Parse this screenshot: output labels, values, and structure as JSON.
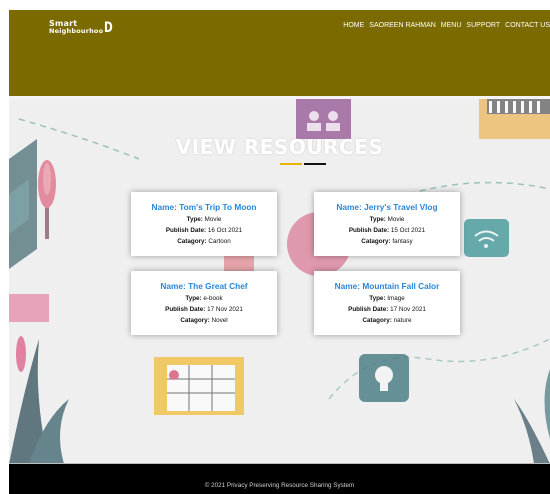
{
  "brand": {
    "line1": "Smart",
    "line2": "Neighbourhoo",
    "line3": "D"
  },
  "nav": [
    "HOME",
    "SAOREEN RAHMAN",
    "MENU",
    "SUPPORT",
    "CONTACT US"
  ],
  "hero": {
    "title": "VIEW RESOURCES"
  },
  "labels": {
    "name": "Name:",
    "type": "Type:",
    "publish_date": "Publish Date:",
    "category": "Catagory:"
  },
  "resources": [
    {
      "name": "Tom's Trip To Moon",
      "type": "Movie",
      "publish_date": "16 Oct 2021",
      "category": "Cartoon"
    },
    {
      "name": "Jerry's Travel Vlog",
      "type": "Movie",
      "publish_date": "15 Oct 2021",
      "category": "fantasy"
    },
    {
      "name": "The Great Chef",
      "type": "e-book",
      "publish_date": "17 Nov 2021",
      "category": "Novel"
    },
    {
      "name": "Mountain Fall Calor",
      "type": "Image",
      "publish_date": "17 Nov 2021",
      "category": "nature"
    }
  ],
  "footer": {
    "text": "© 2021 Privacy Preserving Resource Sharing System"
  },
  "colors": {
    "header": "#7b6a00",
    "link": "#2a86d8",
    "accent_yellow": "#e8b400",
    "footer": "#000000"
  },
  "icons": [
    "user-group-icon",
    "wifi-icon",
    "lightbulb-icon",
    "calendar-icon",
    "building-icon",
    "plant-icon",
    "arrow-icon"
  ]
}
